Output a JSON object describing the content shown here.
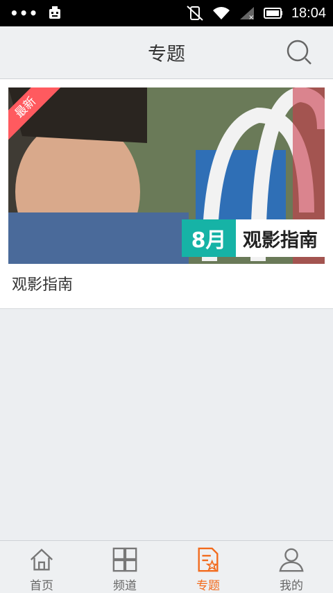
{
  "status_bar": {
    "time": "18:04",
    "icons": [
      "more-dots-icon",
      "android-debug-icon",
      "vibrate-off-icon",
      "wifi-icon",
      "signal-icon",
      "battery-icon"
    ]
  },
  "header": {
    "title": "专题",
    "search_icon": "search-icon"
  },
  "topic_list": [
    {
      "badge": "最新",
      "promo_month": "8月",
      "promo_text": "观影指南",
      "title": "观影指南"
    }
  ],
  "tabs": [
    {
      "label": "首页",
      "icon": "home-icon",
      "active": false
    },
    {
      "label": "频道",
      "icon": "grid-icon",
      "active": false
    },
    {
      "label": "专题",
      "icon": "topic-icon",
      "active": true
    },
    {
      "label": "我的",
      "icon": "profile-icon",
      "active": false
    }
  ],
  "colors": {
    "accent": "#f26b1d",
    "badge": "#ff5a5f",
    "promo": "#16b3a6"
  }
}
